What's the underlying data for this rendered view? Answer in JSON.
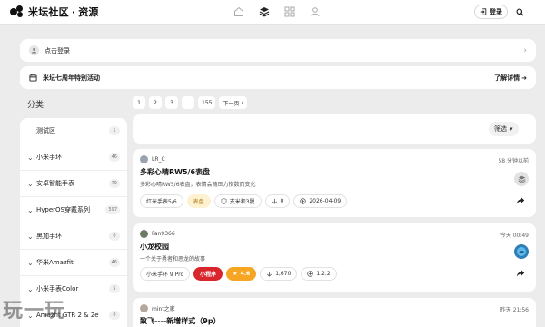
{
  "header": {
    "site_name": "米坛社区",
    "separator": "·",
    "section": "资源",
    "nav_icons": [
      "home-icon",
      "layers-icon",
      "grid-icon",
      "user-icon"
    ],
    "login_label": "登录"
  },
  "login_banner": {
    "text": "点击登录"
  },
  "event_banner": {
    "text": "米坛七周年特别活动",
    "link": "了解详情"
  },
  "sidebar": {
    "heading": "分类",
    "items": [
      {
        "label": "测试区",
        "count": "1",
        "expandable": false
      },
      {
        "label": "小米手环",
        "count": "46",
        "expandable": true
      },
      {
        "label": "安卓智能手表",
        "count": "79",
        "expandable": true
      },
      {
        "label": "HyperOS穿戴系列",
        "count": "597",
        "expandable": true
      },
      {
        "label": "黑加手环",
        "count": "0",
        "expandable": true
      },
      {
        "label": "华米Amazfit",
        "count": "46",
        "expandable": true
      },
      {
        "label": "小米手表Color",
        "count": "5",
        "expandable": true
      },
      {
        "label": "Amazfit GTR 2 & 2e",
        "count": "0",
        "expandable": true
      }
    ]
  },
  "pagination": {
    "pages": [
      "1",
      "2",
      "3",
      "…",
      "155"
    ],
    "next": "下一页"
  },
  "filter": {
    "label": "筛选"
  },
  "resources": [
    {
      "author": "LR_C",
      "time": "58 分钟以前",
      "title": "多彩心晴RW5/6表盘",
      "description": "多彩心晴RW5/6表盘，表情会随压力指数而变化",
      "device": "红米手表5/6",
      "tag": "表盘",
      "extra": "支米和3脱",
      "downloads": "0",
      "date": "2026-04-09"
    },
    {
      "author": "Fan9366",
      "time": "今天 00:49",
      "title": "小龙校园",
      "description": "一个关于勇者和恶龙的故事",
      "device": "小米手环 9 Pro",
      "tag": "小程序",
      "rating": "4.6",
      "downloads": "1,670",
      "version": "1.2.2"
    },
    {
      "author": "mint之家",
      "time": "昨天 21:56",
      "title": "致飞----新增样式（9p）"
    }
  ],
  "watermark": "玩一玩"
}
